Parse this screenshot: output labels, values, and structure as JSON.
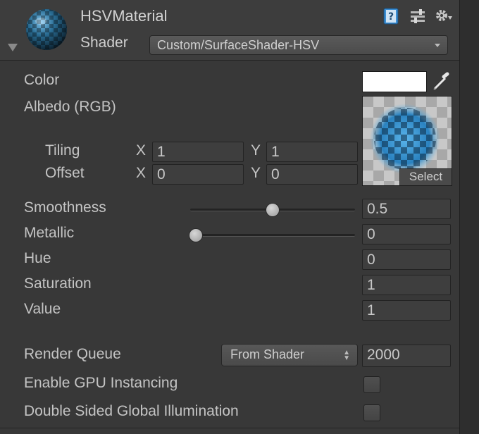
{
  "header": {
    "material_name": "HSVMaterial",
    "shader_label": "Shader",
    "shader_value": "Custom/SurfaceShader-HSV",
    "icons": [
      "help-book-icon",
      "presets-sliders-icon",
      "gear-icon"
    ]
  },
  "properties": {
    "color_label": "Color",
    "color_value": "#ffffff",
    "albedo_label": "Albedo (RGB)",
    "select_label": "Select",
    "tiling": {
      "label": "Tiling",
      "x_label": "X",
      "x": "1",
      "y_label": "Y",
      "y": "1"
    },
    "offset": {
      "label": "Offset",
      "x_label": "X",
      "x": "0",
      "y_label": "Y",
      "y": "0"
    },
    "smoothness": {
      "label": "Smoothness",
      "value": "0.5",
      "fraction": 0.5
    },
    "metallic": {
      "label": "Metallic",
      "value": "0",
      "fraction": 0
    },
    "hue": {
      "label": "Hue",
      "value": "0"
    },
    "saturation": {
      "label": "Saturation",
      "value": "1"
    },
    "value": {
      "label": "Value",
      "value": "1"
    }
  },
  "advanced": {
    "render_queue_label": "Render Queue",
    "render_queue_mode": "From Shader",
    "render_queue_value": "2000",
    "gpu_instancing_label": "Enable GPU Instancing",
    "gpu_instancing_checked": false,
    "double_sided_gi_label": "Double Sided Global Illumination",
    "double_sided_gi_checked": false
  },
  "colors": {
    "background": "#383838",
    "accent_blue": "#3a8ed4"
  }
}
